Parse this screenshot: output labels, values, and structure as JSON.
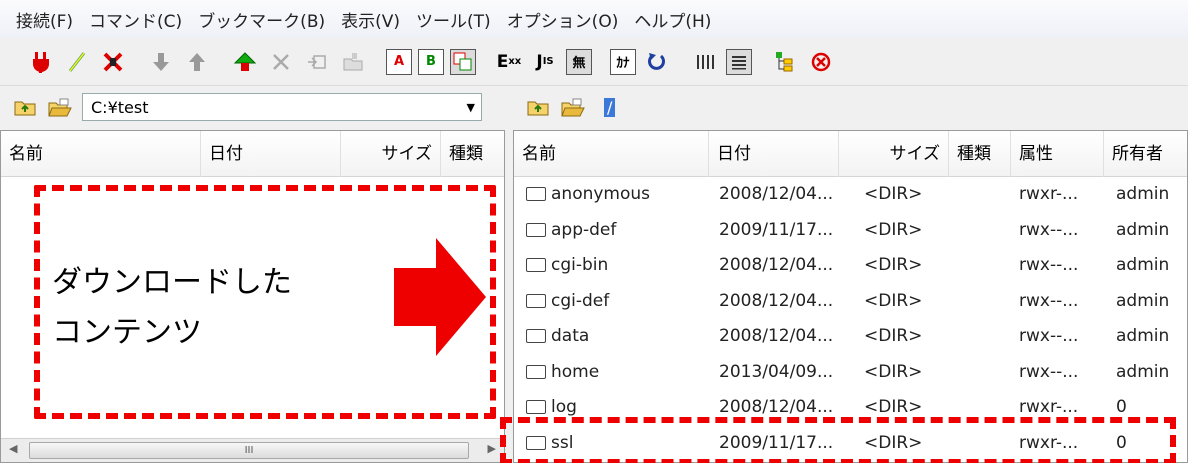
{
  "menu": [
    "接続(F)",
    "コマンド(C)",
    "ブックマーク(B)",
    "表示(V)",
    "ツール(T)",
    "オプション(O)",
    "ヘルプ(H)"
  ],
  "toolbar": {
    "icons": [
      "connect-icon",
      "quick-connect-icon",
      "disconnect-icon",
      "download-icon",
      "upload-icon",
      "mirror-upload-icon",
      "delete-icon",
      "rename-icon",
      "mkdir-icon",
      "ascii-mode-icon",
      "binary-mode-icon",
      "auto-mode-icon",
      "euc-icon",
      "jis-icon",
      "no-convert-icon",
      "kana-icon",
      "refresh-icon",
      "list-view-icon",
      "detail-view-icon",
      "tree-icon",
      "stop-icon"
    ],
    "labels": {
      "ascii": "A",
      "binary": "B",
      "euc": "E",
      "jis": "J",
      "none": "無",
      "kana": "ｶﾅ"
    }
  },
  "left": {
    "path": "C:¥test",
    "columns": [
      "名前",
      "日付",
      "サイズ",
      "種類"
    ]
  },
  "right": {
    "path": "/",
    "columns": [
      "名前",
      "日付",
      "サイズ",
      "種類",
      "属性",
      "所有者"
    ],
    "rows": [
      {
        "name": "anonymous",
        "date": "2008/12/04...",
        "size": "<DIR>",
        "type": "",
        "attr": "rwxr-...",
        "owner": "admin"
      },
      {
        "name": "app-def",
        "date": "2009/11/17...",
        "size": "<DIR>",
        "type": "",
        "attr": "rwx--...",
        "owner": "admin"
      },
      {
        "name": "cgi-bin",
        "date": "2008/12/04...",
        "size": "<DIR>",
        "type": "",
        "attr": "rwx--...",
        "owner": "admin"
      },
      {
        "name": "cgi-def",
        "date": "2008/12/04...",
        "size": "<DIR>",
        "type": "",
        "attr": "rwx--...",
        "owner": "admin"
      },
      {
        "name": "data",
        "date": "2008/12/04...",
        "size": "<DIR>",
        "type": "",
        "attr": "rwx--...",
        "owner": "admin"
      },
      {
        "name": "home",
        "date": "2013/04/09...",
        "size": "<DIR>",
        "type": "",
        "attr": "rwx--...",
        "owner": "admin"
      },
      {
        "name": "log",
        "date": "2008/12/04...",
        "size": "<DIR>",
        "type": "",
        "attr": "rwxr-...",
        "owner": "0"
      },
      {
        "name": "ssl",
        "date": "2009/11/17...",
        "size": "<DIR>",
        "type": "",
        "attr": "rwxr-...",
        "owner": "0"
      }
    ]
  },
  "annotation": {
    "label_line1": "ダウンロードした",
    "label_line2": "コンテンツ",
    "color": "#ee0000"
  },
  "scroll_grip": "III"
}
